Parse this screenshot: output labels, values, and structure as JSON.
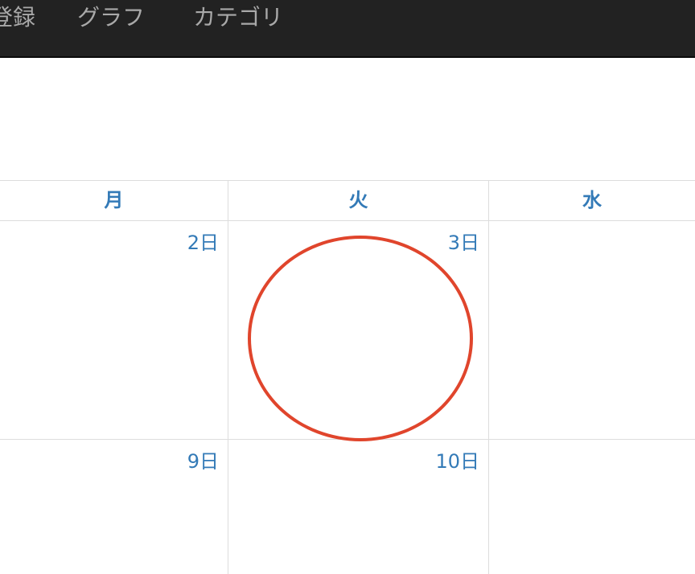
{
  "navbar": {
    "items": [
      {
        "label": "登録"
      },
      {
        "label": "グラフ"
      },
      {
        "label": "カテゴリ"
      }
    ]
  },
  "calendar": {
    "weekdays": [
      "月",
      "火",
      "水"
    ],
    "weeks": [
      {
        "days": [
          "2日",
          "3日",
          ""
        ]
      },
      {
        "days": [
          "9日",
          "10日",
          ""
        ]
      }
    ],
    "stamp": {
      "day": "3日",
      "shape": "circle",
      "color": "#e0452c"
    }
  },
  "colors": {
    "navbar_bg": "#222222",
    "nav_text": "#a9a9a9",
    "accent": "#337ab7",
    "grid_line": "#dddddd",
    "stamp": "#e0452c"
  }
}
